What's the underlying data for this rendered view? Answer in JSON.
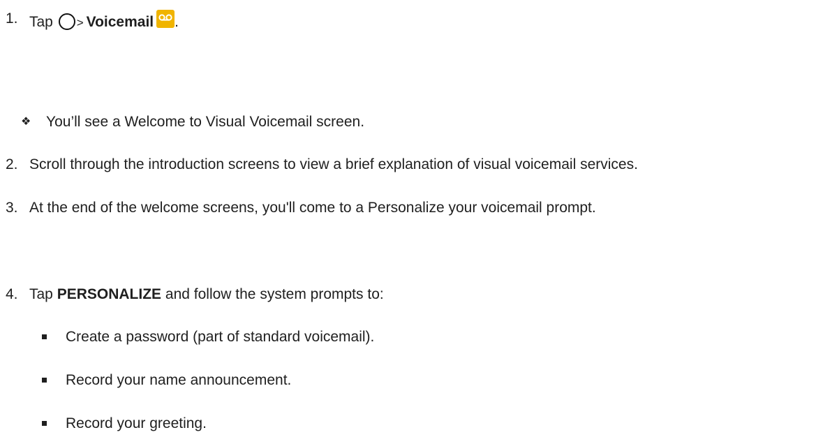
{
  "steps": [
    {
      "number": "1.",
      "tap_word": "Tap",
      "separator": ">",
      "target_label": "Voicemail",
      "trailing_punct": ".",
      "icons": [
        "home-button-icon",
        "voicemail-app-icon"
      ]
    },
    {
      "number": "2.",
      "text": "Scroll through the introduction screens to view a brief explanation of visual voicemail services."
    },
    {
      "number": "3.",
      "text": "At the end of the welcome screens, you'll come to a Personalize your voicemail prompt."
    },
    {
      "number": "4.",
      "tap_word": "Tap",
      "target_label": "PERSONALIZE",
      "rest": " and follow the system prompts to:"
    }
  ],
  "note": {
    "bullet": "❖",
    "text": "You’ll see a Welcome to Visual Voicemail screen."
  },
  "sub_bullets": [
    "Create a password (part of standard voicemail).",
    "Record your name announcement.",
    "Record your greeting."
  ],
  "colors": {
    "text": "#1f1f1f",
    "voicemail_icon_bg": "#f0b400"
  }
}
